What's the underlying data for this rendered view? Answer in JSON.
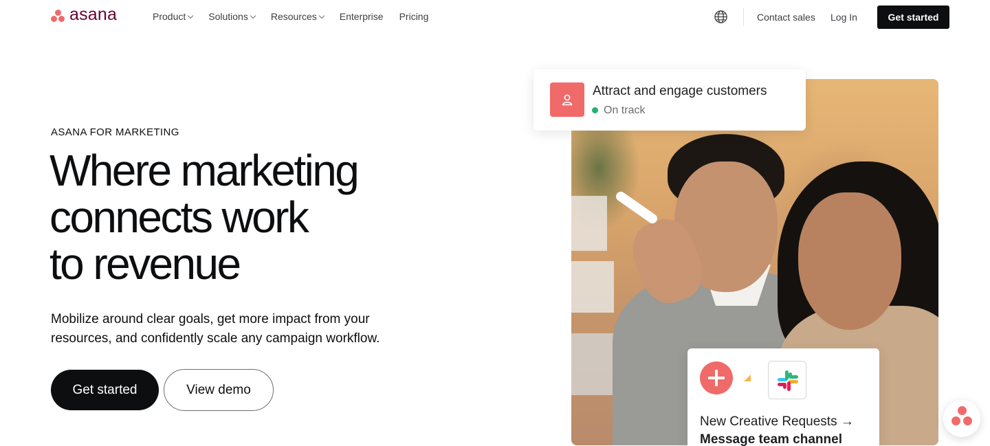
{
  "brand": {
    "name": "asana",
    "accent": "#f06a6a",
    "wordmark_color": "#690031"
  },
  "nav": {
    "items": [
      {
        "label": "Product",
        "has_dropdown": true
      },
      {
        "label": "Solutions",
        "has_dropdown": true
      },
      {
        "label": "Resources",
        "has_dropdown": true
      },
      {
        "label": "Enterprise",
        "has_dropdown": false
      },
      {
        "label": "Pricing",
        "has_dropdown": false
      }
    ],
    "language_icon": "globe-icon",
    "contact_label": "Contact sales",
    "login_label": "Log In",
    "cta_label": "Get started"
  },
  "hero": {
    "eyebrow": "ASANA FOR MARKETING",
    "headline_lines": [
      "Where marketing",
      "connects work",
      "to revenue"
    ],
    "subcopy_lines": [
      "Mobilize around clear goals, get more impact from your",
      "resources, and confidently scale any campaign workflow."
    ],
    "primary_cta": "Get started",
    "secondary_cta": "View demo"
  },
  "goal_card": {
    "icon": "person-icon",
    "title": "Attract and engage customers",
    "status": "On track",
    "status_color": "#23b26d"
  },
  "rule_card": {
    "trigger_icon": "plus-icon",
    "action_icon": "slack-icon",
    "line1": "New Creative Requests →",
    "line2": "Message team channel"
  },
  "chat_widget": {
    "icon": "asana-chat-icon"
  }
}
